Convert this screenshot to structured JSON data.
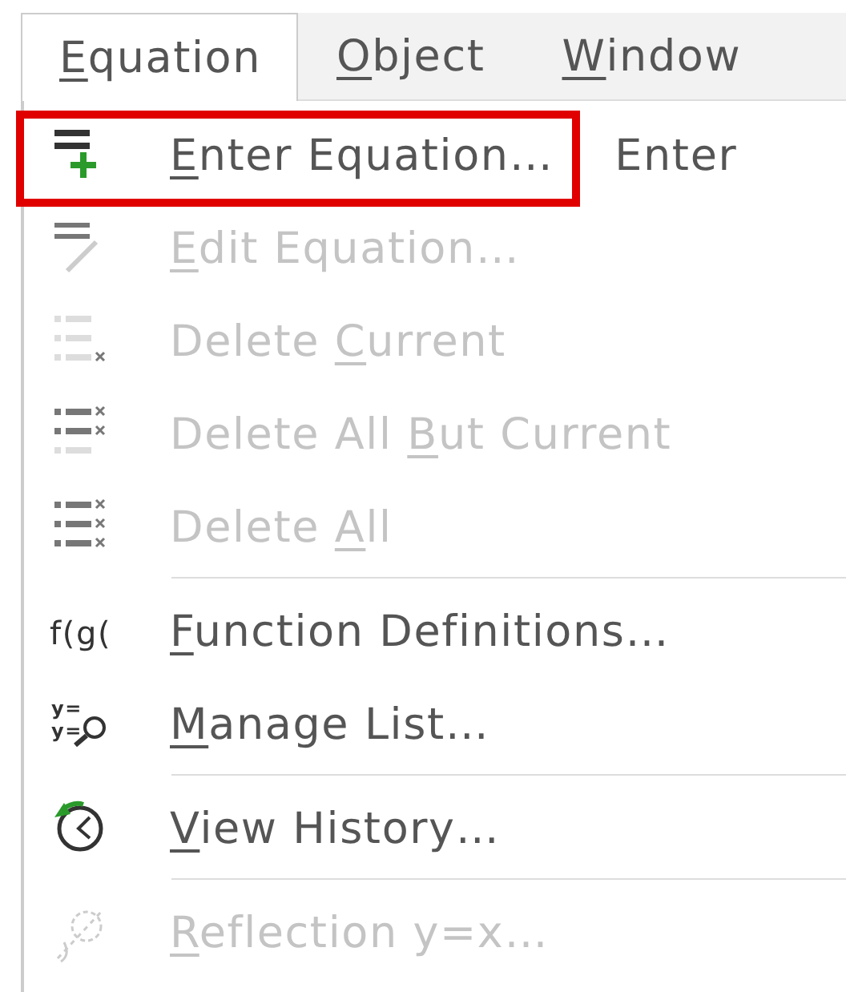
{
  "menubar": [
    {
      "key": "E",
      "post": "quation",
      "selected": true
    },
    {
      "key": "O",
      "post": "bject",
      "selected": false
    },
    {
      "key": "W",
      "post": "indow",
      "selected": false
    }
  ],
  "menu": [
    {
      "kind": "item",
      "key": "E",
      "post": "nter Equation…",
      "shortcut": "Enter",
      "disabled": false,
      "highlighted": true
    },
    {
      "kind": "item",
      "key": "E",
      "post": "dit Equation…",
      "disabled": true,
      "highlighted": false
    },
    {
      "kind": "item",
      "pre": "Delete ",
      "key": "C",
      "post": "urrent",
      "disabled": true,
      "highlighted": false
    },
    {
      "kind": "item",
      "pre": "Delete All ",
      "key": "B",
      "post": "ut Current",
      "disabled": true,
      "highlighted": false
    },
    {
      "kind": "item",
      "pre": "Delete ",
      "key": "A",
      "post": "ll",
      "disabled": true,
      "highlighted": false
    },
    {
      "kind": "separator"
    },
    {
      "kind": "item",
      "icon_text": [
        "f(g("
      ],
      "key": "F",
      "post": "unction Definitions…",
      "disabled": false,
      "highlighted": false
    },
    {
      "kind": "item",
      "icon_text": [
        "y=",
        "y="
      ],
      "key": "M",
      "post": "anage List…",
      "disabled": false,
      "highlighted": false
    },
    {
      "kind": "separator"
    },
    {
      "kind": "item",
      "key": "V",
      "post": "iew History…",
      "disabled": false,
      "highlighted": false
    },
    {
      "kind": "separator"
    },
    {
      "kind": "item",
      "key": "R",
      "post": "eflection y=x…",
      "disabled": true,
      "highlighted": false
    }
  ]
}
